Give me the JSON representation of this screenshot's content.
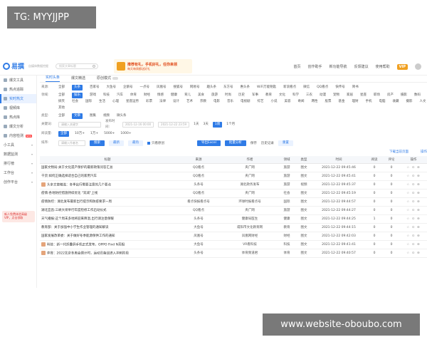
{
  "watermark": {
    "tg": "TG: MYYJJPP",
    "site": "www.website-oboubo.com"
  },
  "header": {
    "logo": "易撰",
    "logo_sub": "自媒体数据挖掘",
    "search_placeholder": "搜索文章标题",
    "banner_line1": "推荐有礼，手机好礼，任你来领",
    "banner_line2": "每天每周都送好礼",
    "nav": [
      "首页",
      "创作助手",
      "新功能导航",
      "反馈建议",
      "使用帮助"
    ],
    "vip": "VIP"
  },
  "sidebar": {
    "items": [
      {
        "label": "爆文工具",
        "active": false
      },
      {
        "label": "热点追踪",
        "active": false
      },
      {
        "label": "实时热文",
        "active": true
      },
      {
        "label": "视频库",
        "active": false
      },
      {
        "label": "热点库",
        "active": false
      },
      {
        "label": "爆文分析",
        "active": false
      },
      {
        "label": "内容检测",
        "active": false,
        "badge": "NEW"
      }
    ],
    "groups": [
      "小工具",
      "数据监测",
      "排行榜",
      "工作台",
      "创作平台"
    ],
    "promo": "新人免费体验高级VIP，点击领取"
  },
  "main": {
    "tabs": [
      "实时头条",
      "爆文精选",
      "原创模式"
    ],
    "filters": [
      {
        "label": "来源:",
        "options": [
          "全部",
          "头条",
          "百家号",
          "大鱼号",
          "企鹅号",
          "一点号",
          "凤凰号",
          "搜狐号",
          "网易号",
          "趣头条",
          "东方号",
          "惠头条",
          "WiFi万能钥匙",
          "新浪看点",
          "微信",
          "QQ看点",
          "快传号",
          "简书"
        ],
        "selected": 1
      },
      {
        "label": "领域:",
        "options": [
          "全部",
          "娱乐",
          "游戏",
          "科技",
          "汽车",
          "体育",
          "财经",
          "情感",
          "健康",
          "育儿",
          "美食",
          "旅游",
          "时尚",
          "历史",
          "军事",
          "教育",
          "文化",
          "科学",
          "三农",
          "动漫",
          "宠物",
          "家居",
          "星座",
          "职场",
          "房产",
          "摄影",
          "数码",
          "搞笑",
          "社会",
          "国际",
          "生活",
          "心理",
          "星座运势",
          "彩票",
          "法律",
          "设计",
          "艺术",
          "宗教",
          "电影",
          "音乐",
          "电视剧",
          "综艺",
          "小说",
          "美容",
          "奇闻",
          "两性",
          "股票",
          "基金",
          "理财",
          "手机",
          "电脑",
          "收藏",
          "摄影",
          "人文",
          "其他"
        ],
        "selected": 1
      },
      {
        "label": "类型:",
        "options": [
          "全部",
          "文章",
          "图集",
          "视频",
          "微头条"
        ],
        "selected": 1
      }
    ],
    "keyword_label": "关键词:",
    "keyword_placeholder": "请输入关键字",
    "time_label": "发布时间:",
    "time_start": "2021-12-16 00:00",
    "time_end": "2021-12-22 23:59",
    "time_options": [
      "1天",
      "3天",
      "1周",
      "1个月"
    ],
    "read_label": "阅读量:",
    "read_options": [
      "全部",
      "10万+",
      "1万+",
      "5000+",
      "1000+"
    ],
    "search_btn": "搜索",
    "reset_btn": "重置",
    "sort_label": "排序:",
    "sort_options": [
      "最新",
      "最热"
    ],
    "only_original": "只看原创",
    "author_placeholder": "请输入作者名",
    "export_btn": "导出Excel",
    "analysis_btn": "批量分析",
    "saved_label": "保存",
    "history_label": "历史记录",
    "download_link": "下载当前页面",
    "ops_link": "操作",
    "columns": [
      "标题",
      "来源",
      "作者",
      "领域",
      "类型",
      "时间",
      "阅读",
      "评论",
      "操作"
    ],
    "rows": [
      {
        "title": "国家文物局:关于文化遗产保护的最新政策问答汇总",
        "source": "QQ看点",
        "author": "央广网",
        "field": "旅游",
        "type": "图文",
        "time": "2021-12-22 09:45:46",
        "read": "0",
        "comment": "0"
      },
      {
        "title": "干货:如何正确选择适合自己的家用汽车",
        "source": "QQ看点",
        "author": "央广网",
        "field": "旅游",
        "type": "图文",
        "time": "2021-12-22 09:45:41",
        "read": "0",
        "comment": "0"
      },
      {
        "title": "头条文章精选：冬季出行需要注意的几个要点",
        "source": "头条号",
        "author": "湖北政务发布",
        "field": "旅游",
        "type": "视频",
        "time": "2021-12-22 09:45:37",
        "read": "0",
        "comment": "0"
      },
      {
        "title": "疫情:各地防控措施持续优化 \"双减\"上线",
        "source": "QQ看点",
        "author": "央广网",
        "field": "社会",
        "type": "图文",
        "time": "2021-12-22 09:45:19",
        "read": "0",
        "comment": "0"
      },
      {
        "title": "疫情防控：湖北发布最新出行提示和防疫要求一周",
        "source": "看点快报看点号",
        "author": "环球时报看点号",
        "field": "国际",
        "type": "图文",
        "time": "2021-12-22 09:44:57",
        "read": "0",
        "comment": "0"
      },
      {
        "title": "湖北宜昌:三峡大坝举行年度检修工作启动仪式",
        "source": "QQ看点",
        "author": "央广网",
        "field": "旅游",
        "type": "图文",
        "time": "2021-12-22 09:44:27",
        "read": "0",
        "comment": "0"
      },
      {
        "title": "天气播报:这个周末多地将迎来降温,出行请注意保暖",
        "source": "头条号",
        "author": "健康局医生",
        "field": "健康",
        "type": "图文",
        "time": "2021-12-22 09:44:25",
        "read": "1",
        "comment": "0"
      },
      {
        "title": "教育部：关于加强中小学生作业管理的通知解读",
        "source": "大鱼号",
        "author": "咸阳市文化教育网",
        "field": "教育",
        "type": "图文",
        "time": "2021-12-22 09:44:15",
        "read": "0",
        "comment": "0"
      },
      {
        "title": "国家发展改革委：关于做好冬季能源保供工作的通知",
        "source": "凤凰号",
        "author": "凤凰网财经",
        "field": "财经",
        "type": "图文",
        "time": "2021-12-22 09:42:03",
        "read": "0",
        "comment": "0"
      },
      {
        "title": "科技：新一代折叠屏手机正式发布，OPPO Find N亮相",
        "source": "大鱼号",
        "author": "VR看科技",
        "field": "科技",
        "type": "图文",
        "time": "2021-12-22 09:41:41",
        "read": "0",
        "comment": "0"
      },
      {
        "title": "体育：2022北京冬奥会倒计时，运动员备战进入冲刺阶段",
        "source": "头条号",
        "author": "体育频道君",
        "field": "体育",
        "type": "图文",
        "time": "2021-12-22 09:40:57",
        "read": "0",
        "comment": "0"
      }
    ],
    "row_actions": "☆ ⊙ ⊕"
  }
}
